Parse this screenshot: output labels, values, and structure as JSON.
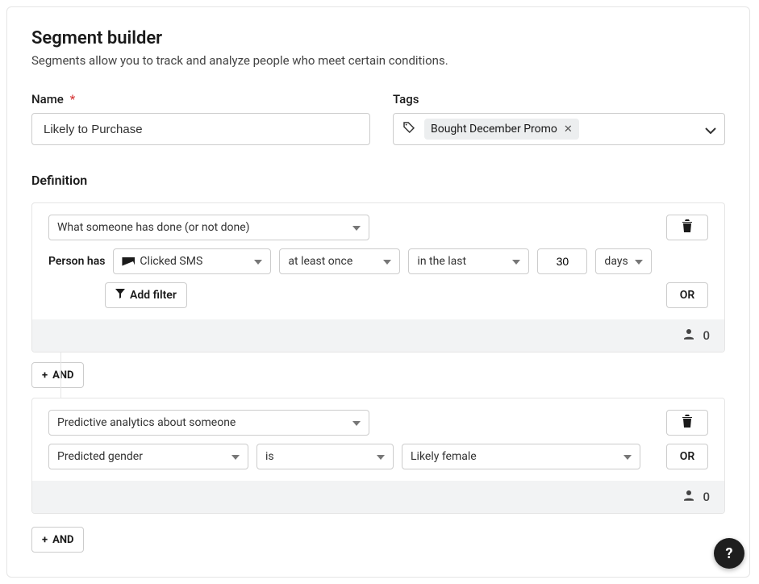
{
  "header": {
    "title": "Segment builder",
    "subtitle": "Segments allow you to track and analyze people who meet certain conditions."
  },
  "fields": {
    "name_label": "Name",
    "required_marker": "*",
    "name_value": "Likely to Purchase",
    "tags_label": "Tags",
    "tag_chip": "Bought December Promo"
  },
  "definition": {
    "heading": "Definition",
    "block1": {
      "condition_type": "What someone has done (or not done)",
      "person_has_label": "Person has",
      "metric": "Clicked SMS",
      "frequency": "at least once",
      "timeframe": "in the last",
      "number": "30",
      "unit": "days",
      "add_filter": "Add filter",
      "or_label": "OR",
      "count": "0"
    },
    "and_pill_1": "AND",
    "block2": {
      "condition_type": "Predictive analytics about someone",
      "dimension": "Predicted gender",
      "operator": "is",
      "value": "Likely female",
      "or_label": "OR",
      "count": "0"
    },
    "and_pill_2": "AND"
  },
  "help": {
    "label": "?"
  }
}
